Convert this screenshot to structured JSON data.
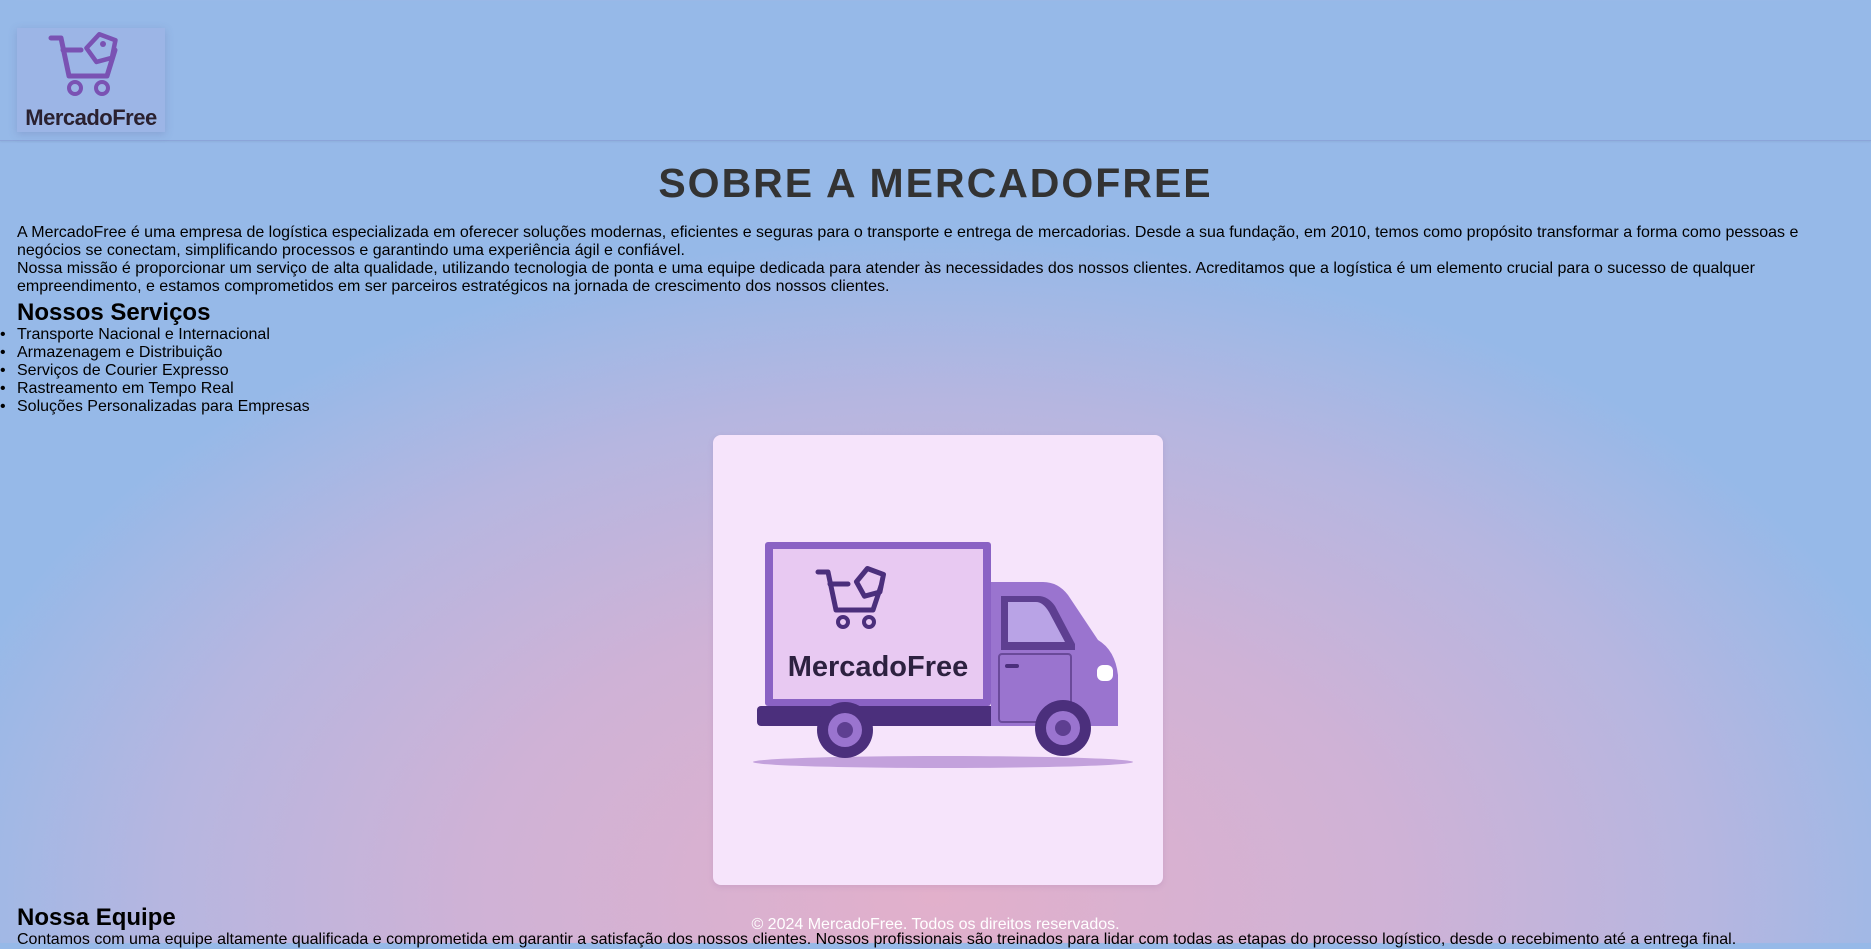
{
  "header": {
    "logo_text": "MercadoFree"
  },
  "page": {
    "title": "SOBRE A MERCADOFREE"
  },
  "intro": {
    "paragraphs": [
      "A MercadoFree é uma empresa de logística especializada em oferecer soluções modernas, eficientes e seguras para o transporte e entrega de mercadorias. Desde a sua fundação, em 2010, temos como propósito transformar a forma como pessoas e negócios se conectam, simplificando processos e garantindo uma experiência ágil e confiável.",
      "Nossa missão é proporcionar um serviço de alta qualidade, utilizando tecnologia de ponta e uma equipe dedicada para atender às necessidades dos nossos clientes. Acreditamos que a logística é um elemento crucial para o sucesso de qualquer empreendimento, e estamos comprometidos em ser parceiros estratégicos na jornada de crescimento dos nossos clientes."
    ]
  },
  "services": {
    "heading": "Nossos Serviços",
    "items": [
      "Transporte Nacional e Internacional",
      "Armazenagem e Distribuição",
      "Serviços de Courier Expresso",
      "Rastreamento em Tempo Real",
      "Soluções Personalizadas para Empresas"
    ]
  },
  "truck_image": {
    "brand_text": "MercadoFree"
  },
  "team": {
    "heading": "Nossa Equipe",
    "text": "Contamos com uma equipe altamente qualificada e comprometida em garantir a satisfação dos nossos clientes. Nossos profissionais são treinados para lidar com todas as etapas do processo logístico, desde o recebimento até a entrega final."
  },
  "footer": {
    "copyright": "© 2024 MercadoFree. Todos os direitos reservados."
  },
  "colors": {
    "brand_purple": "#7a52b3",
    "title_gray": "#333333",
    "card_bg": "#f6e4fb"
  }
}
